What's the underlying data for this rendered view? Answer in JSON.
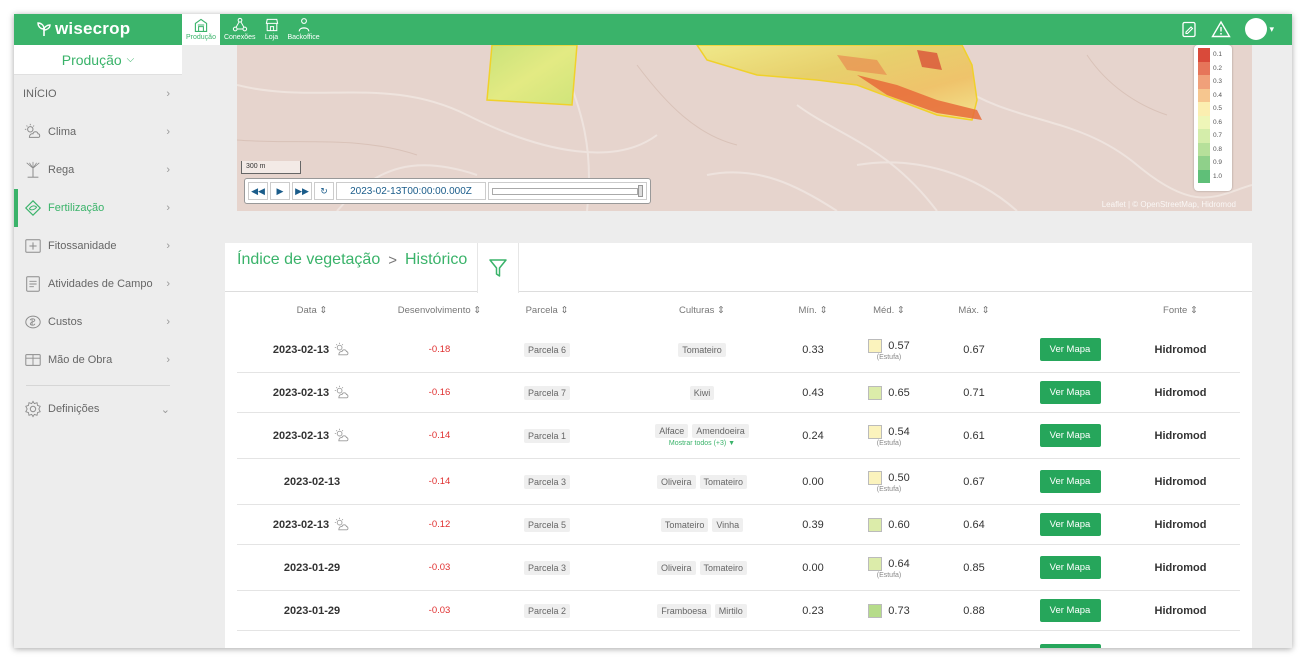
{
  "app": {
    "logo": "wisecrop",
    "tabs": [
      {
        "label": "Produção",
        "icon": "farm-icon",
        "active": true
      },
      {
        "label": "Conexões",
        "icon": "connections-icon",
        "active": false
      },
      {
        "label": "Loja",
        "icon": "store-icon",
        "active": false
      },
      {
        "label": "Backoffice",
        "icon": "backoffice-icon",
        "active": false
      }
    ],
    "brand_color": "#3ab36a"
  },
  "sidebar": {
    "selector": "Produção",
    "items": [
      {
        "label": "INÍCIO",
        "icon": ""
      },
      {
        "label": "Clima",
        "icon": "weather-icon"
      },
      {
        "label": "Rega",
        "icon": "irrigation-icon"
      },
      {
        "label": "Fertilização",
        "icon": "fertilization-icon",
        "active": true
      },
      {
        "label": "Fitossanidade",
        "icon": "plant-health-icon"
      },
      {
        "label": "Atividades de Campo",
        "icon": "field-activities-icon"
      },
      {
        "label": "Custos",
        "icon": "costs-icon"
      },
      {
        "label": "Mão de Obra",
        "icon": "labor-icon"
      },
      {
        "label": "Definições",
        "icon": "settings-icon"
      }
    ]
  },
  "map": {
    "scale": "300 m",
    "date": "2023-02-13T00:00:00.000Z",
    "legend": [
      "0.1",
      "0.2",
      "0.3",
      "0.4",
      "0.5",
      "0.6",
      "0.7",
      "0.8",
      "0.9",
      "1.0"
    ],
    "legend_colors": [
      "#d94a3a",
      "#e6755a",
      "#f0a07a",
      "#f6c68f",
      "#fbeeb0",
      "#eef6b8",
      "#d4edaa",
      "#b6e09a",
      "#8fd08a",
      "#5fbf78"
    ],
    "attribution": "Leaflet | © OpenStreetMap, Hidromod"
  },
  "history": {
    "breadcrumb": [
      "Índice de vegetação",
      "Histórico"
    ],
    "columns": {
      "date": "Data ⇕",
      "dev": "Desenvolvimento ⇕",
      "parcel": "Parcela ⇕",
      "crops": "Culturas ⇕",
      "min": "Mín. ⇕",
      "med": "Méd. ⇕",
      "max": "Máx. ⇕",
      "source": "Fonte ⇕"
    },
    "button_label": "Ver Mapa",
    "rows": [
      {
        "date": "2023-02-13",
        "cloud": true,
        "dev": "-0.18",
        "parcel": "Parcela 6",
        "crops": [
          "Tomateiro"
        ],
        "more": "",
        "min": "0.33",
        "med": "0.57",
        "med_color": "#fbf3bd",
        "sub": "(Estufa)",
        "max": "0.67",
        "source": "Hidromod"
      },
      {
        "date": "2023-02-13",
        "cloud": true,
        "dev": "-0.16",
        "parcel": "Parcela 7",
        "crops": [
          "Kiwi"
        ],
        "more": "",
        "min": "0.43",
        "med": "0.65",
        "med_color": "#dcecaa",
        "sub": "",
        "max": "0.71",
        "source": "Hidromod"
      },
      {
        "date": "2023-02-13",
        "cloud": true,
        "dev": "-0.14",
        "parcel": "Parcela 1",
        "crops": [
          "Alface",
          "Amendoeira"
        ],
        "more": "Mostrar todos (+3) ▼",
        "min": "0.24",
        "med": "0.54",
        "med_color": "#fbf3bd",
        "sub": "(Estufa)",
        "max": "0.61",
        "source": "Hidromod"
      },
      {
        "date": "2023-02-13",
        "cloud": false,
        "dev": "-0.14",
        "parcel": "Parcela 3",
        "crops": [
          "Oliveira",
          "Tomateiro"
        ],
        "more": "",
        "min": "0.00",
        "med": "0.50",
        "med_color": "#fbf3bd",
        "sub": "(Estufa)",
        "max": "0.67",
        "source": "Hidromod"
      },
      {
        "date": "2023-02-13",
        "cloud": true,
        "dev": "-0.12",
        "parcel": "Parcela 5",
        "crops": [
          "Tomateiro",
          "Vinha"
        ],
        "more": "",
        "min": "0.39",
        "med": "0.60",
        "med_color": "#dcecaa",
        "sub": "",
        "max": "0.64",
        "source": "Hidromod"
      },
      {
        "date": "2023-01-29",
        "cloud": false,
        "dev": "-0.03",
        "parcel": "Parcela 3",
        "crops": [
          "Oliveira",
          "Tomateiro"
        ],
        "more": "",
        "min": "0.00",
        "med": "0.64",
        "med_color": "#dcecaa",
        "sub": "(Estufa)",
        "max": "0.85",
        "source": "Hidromod"
      },
      {
        "date": "2023-01-29",
        "cloud": false,
        "dev": "-0.03",
        "parcel": "Parcela 2",
        "crops": [
          "Framboesa",
          "Mirtilo"
        ],
        "more": "",
        "min": "0.23",
        "med": "0.73",
        "med_color": "#b6dc8a",
        "sub": "",
        "max": "0.88",
        "source": "Hidromod"
      }
    ]
  }
}
